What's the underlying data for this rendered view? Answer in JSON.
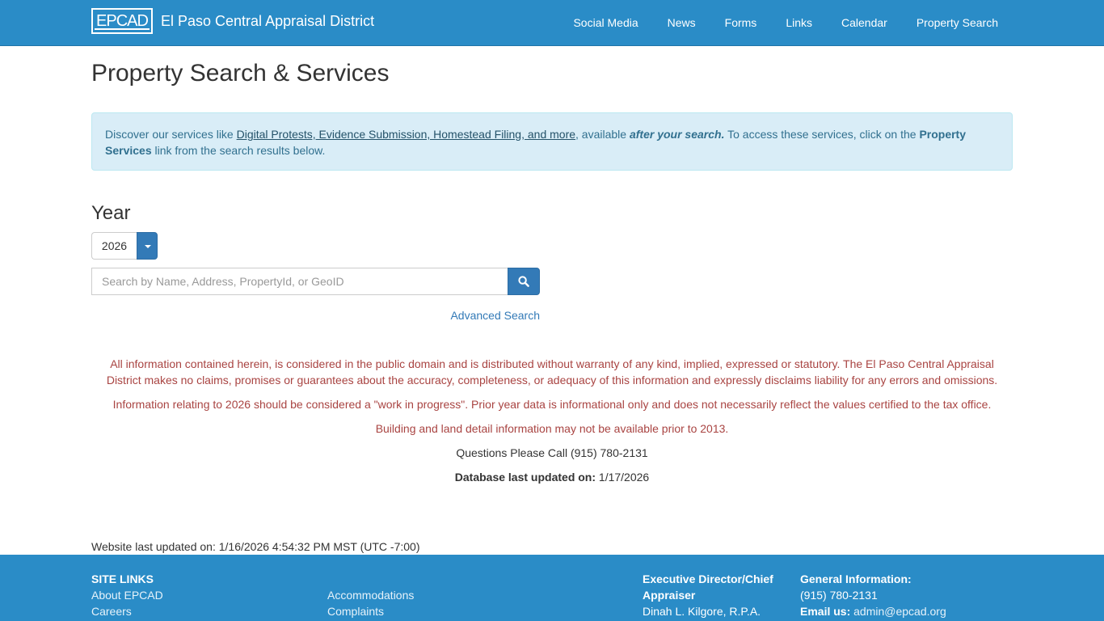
{
  "header": {
    "logo_text": "EPCAD",
    "title": "El Paso Central Appraisal District",
    "nav": [
      "Social Media",
      "News",
      "Forms",
      "Links",
      "Calendar",
      "Property Search"
    ]
  },
  "page": {
    "title": "Property Search & Services"
  },
  "alert": {
    "text1": "Discover our services like ",
    "link": "Digital Protests, Evidence Submission, Homestead Filing, and more",
    "text2": ", available ",
    "emphasis": "after your search.",
    "text3": " To access these services, click on the ",
    "bold": "Property Services",
    "text4": " link from the search results below."
  },
  "search": {
    "year_label": "Year",
    "year_value": "2026",
    "placeholder": "Search by Name, Address, PropertyId, or GeoID",
    "advanced_label": "Advanced Search"
  },
  "disclaimers": {
    "public_domain": "All information contained herein, is considered in the public domain and is distributed without warranty of any kind, implied, expressed or statutory. The El Paso Central Appraisal District makes no claims, promises or guarantees about the accuracy, completeness, or adequacy of this information and expressly disclaims liability for any errors and omissions.",
    "work_in_progress": "Information relating to 2026 should be considered a \"work in progress\". Prior year data is informational only and does not necessarily reflect the values certified to the tax office.",
    "building_detail": "Building and land detail information may not be available prior to 2013.",
    "questions": "Questions Please Call (915) 780-2131",
    "db_updated_label": "Database last updated on:",
    "db_updated_value": "1/17/2026"
  },
  "site_updated": "Website last updated on: 1/16/2026 4:54:32 PM MST (UTC -7:00)",
  "footer": {
    "site_links_header": "SITE LINKS",
    "links_col1": [
      "About EPCAD",
      "Careers"
    ],
    "links_col2": [
      "Accommodations",
      "Complaints"
    ],
    "exec_header_line1": "Executive Director/Chief",
    "exec_header_line2": "Appraiser",
    "exec_name": "Dinah L. Kilgore, R.P.A.",
    "general_header": "General Information:",
    "general_phone": "(915) 780-2131",
    "email_label": "Email us:",
    "email_value": "admin@epcad.org"
  },
  "colors": {
    "brand_blue": "#2a8cc7",
    "button_blue": "#337ab7",
    "alert_bg": "#d9edf7",
    "disclaimer_red": "#a94442"
  }
}
